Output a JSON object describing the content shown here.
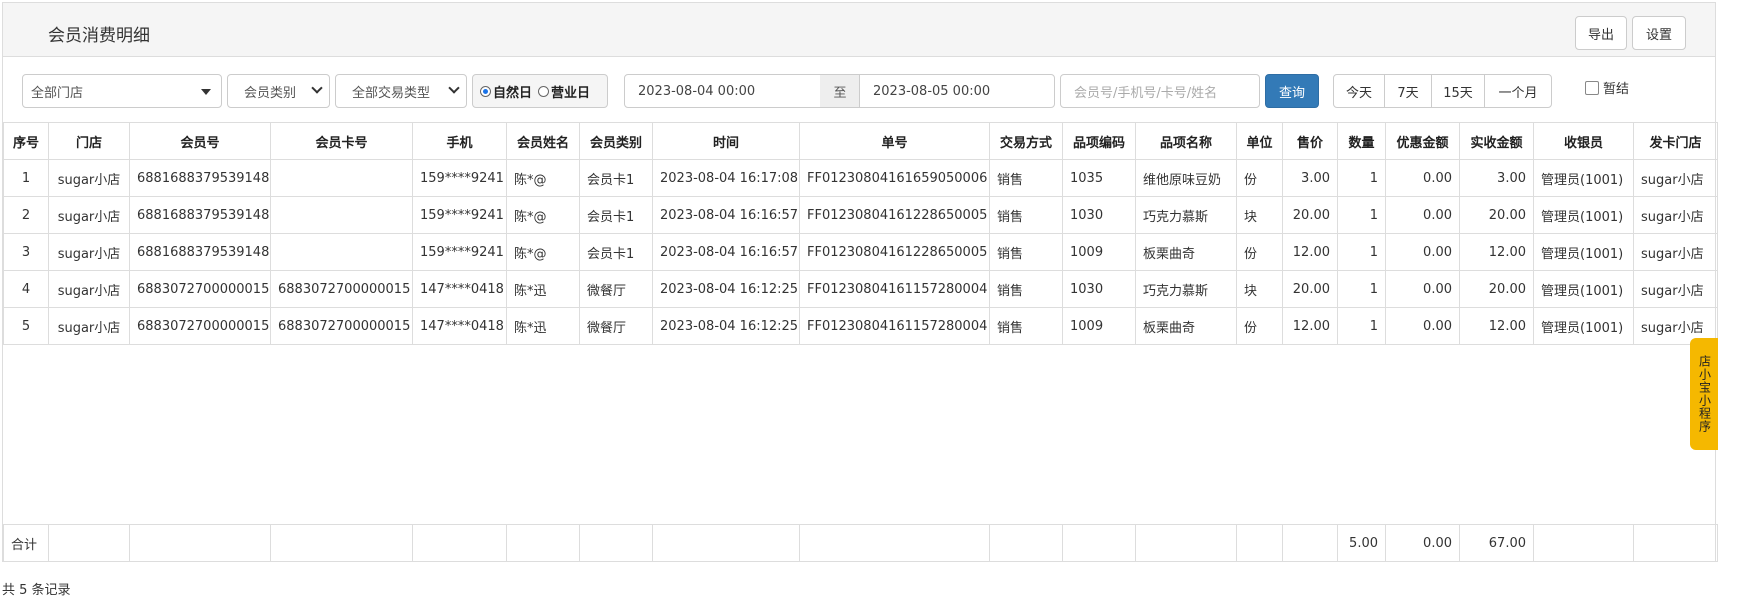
{
  "header": {
    "title": "会员消费明细",
    "export_label": "导出",
    "settings_label": "设置"
  },
  "filters": {
    "store": "全部门店",
    "member_type": "会员类别",
    "trade_type": "全部交易类型",
    "natural_day": "自然日",
    "business_day": "营业日",
    "start_date": "2023-08-04 00:00",
    "to_label": "至",
    "end_date": "2023-08-05 00:00",
    "search_placeholder": "会员号/手机号/卡号/姓名",
    "query_label": "查询",
    "today": "今天",
    "d7": "7天",
    "d15": "15天",
    "month": "一个月",
    "suspend_label": "暂结"
  },
  "table": {
    "columns": [
      "序号",
      "门店",
      "会员号",
      "会员卡号",
      "手机",
      "会员姓名",
      "会员类别",
      "时间",
      "单号",
      "交易方式",
      "品项编码",
      "品项名称",
      "单位",
      "售价",
      "数量",
      "优惠金额",
      "实收金额",
      "收银员",
      "发卡门店"
    ],
    "rows": [
      [
        "1",
        "sugar小店",
        "6881688379539148",
        "",
        "159****9241",
        "陈*@",
        "会员卡1",
        "2023-08-04 16:17:08",
        "FF01230804161659050006",
        "销售",
        "1035",
        "维他原味豆奶",
        "份",
        "3.00",
        "1",
        "0.00",
        "3.00",
        "管理员(1001)",
        "sugar小店"
      ],
      [
        "2",
        "sugar小店",
        "6881688379539148",
        "",
        "159****9241",
        "陈*@",
        "会员卡1",
        "2023-08-04 16:16:57",
        "FF01230804161228650005",
        "销售",
        "1030",
        "巧克力慕斯",
        "块",
        "20.00",
        "1",
        "0.00",
        "20.00",
        "管理员(1001)",
        "sugar小店"
      ],
      [
        "3",
        "sugar小店",
        "6881688379539148",
        "",
        "159****9241",
        "陈*@",
        "会员卡1",
        "2023-08-04 16:16:57",
        "FF01230804161228650005",
        "销售",
        "1009",
        "板栗曲奇",
        "份",
        "12.00",
        "1",
        "0.00",
        "12.00",
        "管理员(1001)",
        "sugar小店"
      ],
      [
        "4",
        "sugar小店",
        "6883072700000015",
        "6883072700000015",
        "147****0418",
        "陈*迅",
        "微餐厅",
        "2023-08-04 16:12:25",
        "FF01230804161157280004",
        "销售",
        "1030",
        "巧克力慕斯",
        "块",
        "20.00",
        "1",
        "0.00",
        "20.00",
        "管理员(1001)",
        "sugar小店"
      ],
      [
        "5",
        "sugar小店",
        "6883072700000015",
        "6883072700000015",
        "147****0418",
        "陈*迅",
        "微餐厅",
        "2023-08-04 16:12:25",
        "FF01230804161157280004",
        "销售",
        "1009",
        "板栗曲奇",
        "份",
        "12.00",
        "1",
        "0.00",
        "12.00",
        "管理员(1001)",
        "sugar小店"
      ]
    ],
    "total_label": "合计",
    "total_qty": "5.00",
    "total_discount": "0.00",
    "total_paid": "67.00"
  },
  "footer": {
    "record_count": "共 5 条记录"
  },
  "side_tab": {
    "label": "店小宝小程序"
  }
}
